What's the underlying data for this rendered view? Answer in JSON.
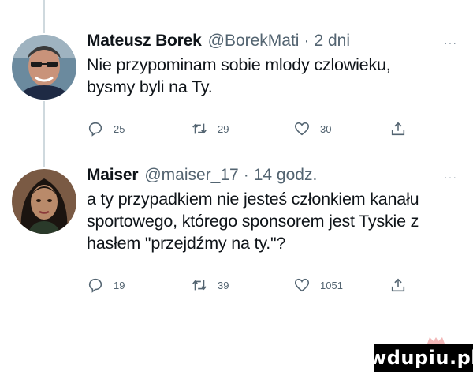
{
  "tweets": [
    {
      "display_name": "Mateusz Borek",
      "handle": "@BorekMati",
      "separator": "·",
      "time": "2 dni",
      "more": "···",
      "text": "Nie przypominam sobie mlody czlowieku,\nbysmy byli na Ty.",
      "replies": "25",
      "retweets": "29",
      "likes": "30",
      "avatar_icon": "person-avatar"
    },
    {
      "display_name": "Maiser",
      "handle": "@maiser_17",
      "separator": "·",
      "time": "14 godz.",
      "more": "···",
      "text": "a ty przypadkiem nie jesteś członkiem kanału\nsportowego, którego sponsorem jest Tyskie z\nhasłem \"przejdźmy na ty.\"?",
      "replies": "19",
      "retweets": "39",
      "likes": "1051",
      "avatar_icon": "person-avatar"
    }
  ],
  "icons": {
    "reply": "reply-icon",
    "retweet": "retweet-icon",
    "like": "like-icon",
    "share": "share-icon"
  },
  "watermark": "wdupiu.pl",
  "colors": {
    "text": "#0f1419",
    "secondary": "#536471",
    "thread_line": "#cfd9de",
    "watermark_bg": "#000000"
  }
}
